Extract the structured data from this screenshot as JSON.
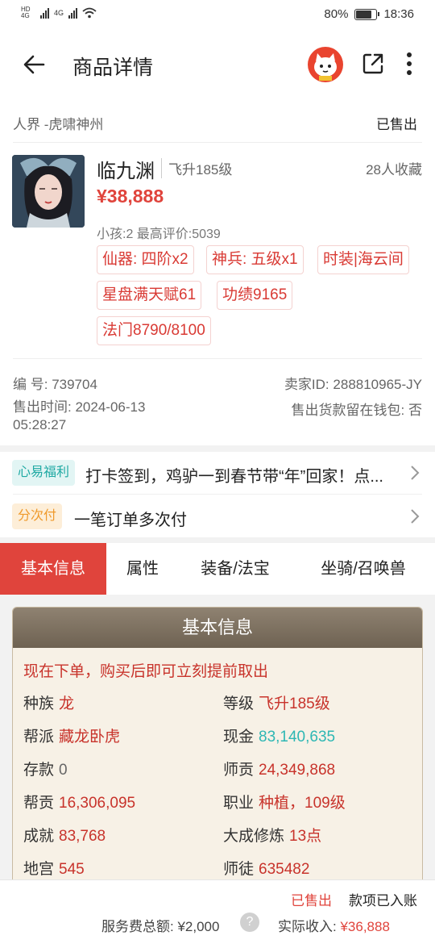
{
  "status_bar": {
    "net1": "HD 4G",
    "net2": "4G",
    "battery": "80%",
    "battery_level": 0.8,
    "time": "18:36"
  },
  "header": {
    "title": "商品详情"
  },
  "product": {
    "server": "人界 -虎啸神州",
    "status": "已售出",
    "name": "临九渊",
    "level": "飞升185级",
    "favorites": "28人收藏",
    "price": "¥38,888",
    "sub_info": "小孩:2 最高评价:5039",
    "tags": [
      "仙器: 四阶x2",
      "神兵: 五级x1",
      "时装|海云间",
      "星盘满天赋61",
      "功绩9165",
      "法门8790/8100"
    ],
    "serial_label": "编 号:",
    "serial": "739704",
    "seller_label": "卖家ID:",
    "seller_id": "288810965-JY",
    "sold_time_label": "售出时间:",
    "sold_date": "2024-06-13",
    "sold_clock": "05:28:27",
    "wallet_label": "售出货款留在钱包:",
    "wallet_value": "否"
  },
  "promos": [
    {
      "badge": "心易福利",
      "text": "打卡签到，鸡驴一到春节带“年”回家！点..."
    },
    {
      "badge": "分次付",
      "text": "一笔订单多次付"
    }
  ],
  "tabs": [
    "基本信息",
    "属性",
    "装备/法宝",
    "坐骑/召唤兽"
  ],
  "basic_info": {
    "title": "基本信息",
    "notice": "现在下单，购买后即可立刻提前取出",
    "left": [
      {
        "label": "种族",
        "value": "龙"
      },
      {
        "label": "帮派",
        "value": "藏龙卧虎"
      },
      {
        "label": "存款",
        "value": "0"
      },
      {
        "label": "帮贡",
        "value": "16,306,095"
      },
      {
        "label": "成就",
        "value": "83,768"
      },
      {
        "label": "地宫",
        "value": "545"
      }
    ],
    "right": [
      {
        "label": "等级",
        "value": "飞升185级"
      },
      {
        "label": "现金",
        "value": "83,140,635"
      },
      {
        "label": "师贡",
        "value": "24,349,868"
      },
      {
        "label": "职业",
        "value": "种植，109级"
      },
      {
        "label": "大成修炼",
        "value": "13点"
      },
      {
        "label": "师徒",
        "value": "635482"
      }
    ]
  },
  "footer": {
    "sold": "已售出",
    "status": "款项已入账",
    "fee_label": "服务费总额:",
    "fee": "¥2,000",
    "income_label": "实际收入:",
    "income": "¥36,888"
  }
}
